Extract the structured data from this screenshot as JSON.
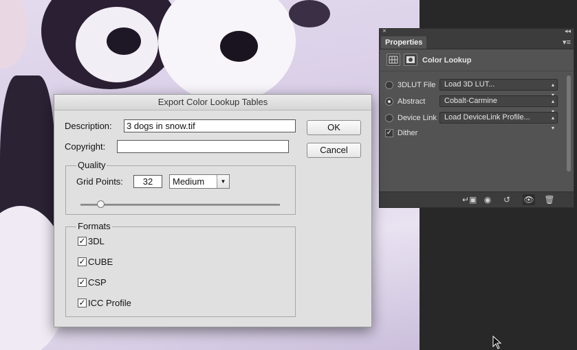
{
  "properties_panel": {
    "tab_label": "Properties",
    "title": "Color Lookup",
    "rows": [
      {
        "label": "3DLUT File",
        "value": "Load 3D LUT...",
        "selected": false
      },
      {
        "label": "Abstract",
        "value": "Cobalt-Carmine",
        "selected": true
      },
      {
        "label": "Device Link",
        "value": "Load DeviceLink Profile...",
        "selected": false
      }
    ],
    "dither_label": "Dither",
    "dither_checked": true
  },
  "dialog": {
    "title": "Export Color Lookup Tables",
    "description_label": "Description:",
    "description_value": "3 dogs in snow.tif",
    "copyright_label": "Copyright:",
    "copyright_value": "",
    "ok_label": "OK",
    "cancel_label": "Cancel",
    "quality": {
      "group_label": "Quality",
      "grid_points_label": "Grid Points:",
      "grid_points_value": "32",
      "preset_value": "Medium",
      "slider_fraction": 0.1
    },
    "formats": {
      "group_label": "Formats",
      "items": [
        {
          "label": "3DL",
          "checked": true
        },
        {
          "label": "CUBE",
          "checked": true
        },
        {
          "label": "CSP",
          "checked": true
        },
        {
          "label": "ICC Profile",
          "checked": true
        }
      ]
    }
  },
  "colors": {
    "panel_bg": "#535353",
    "panel_dark": "#3c3c3c",
    "dialog_bg": "#e0e0e0",
    "photo_tint": "#d8cde6"
  }
}
